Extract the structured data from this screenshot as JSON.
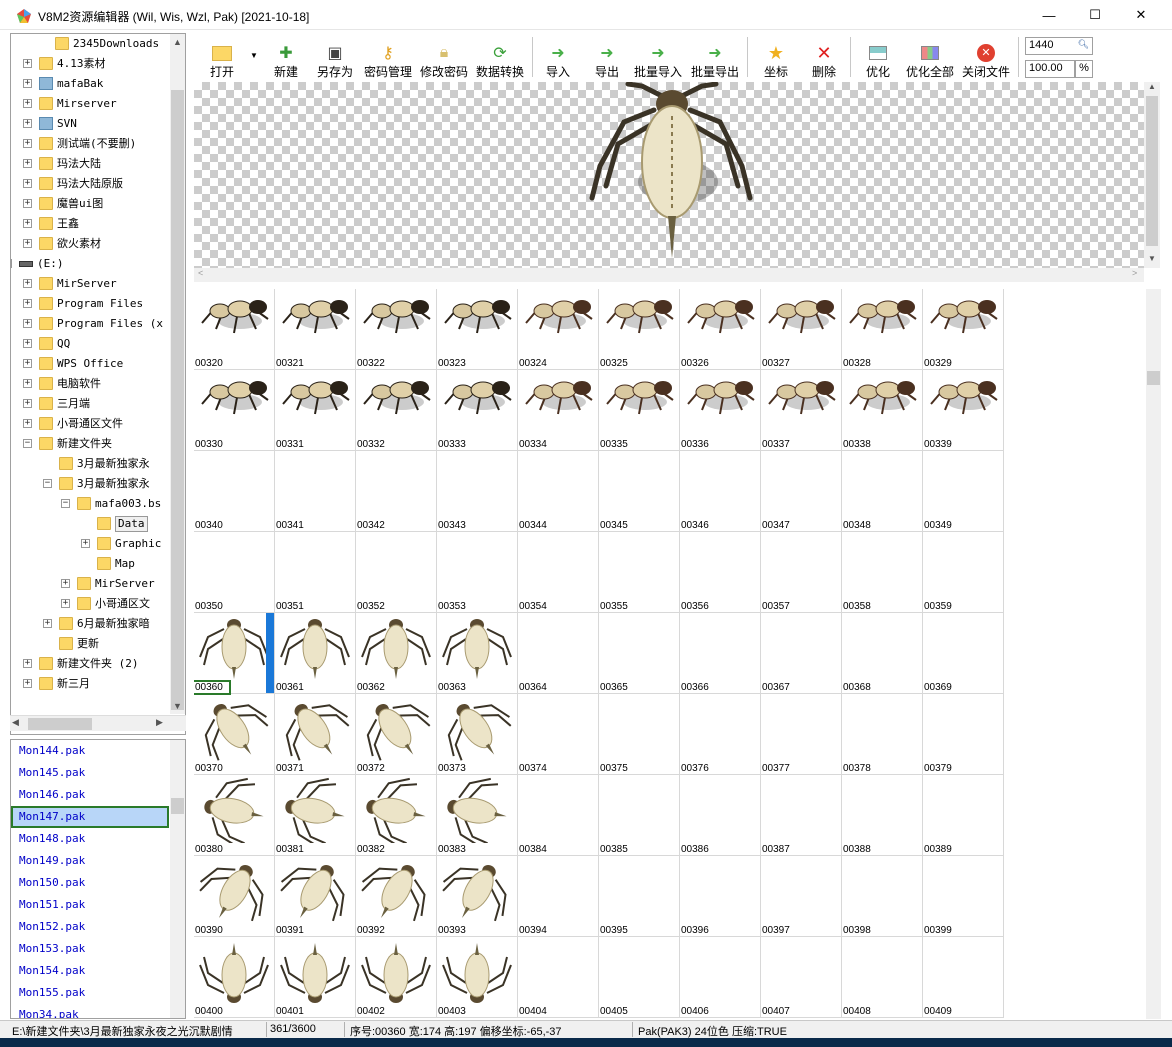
{
  "window": {
    "title": "V8M2资源编辑器 (Wil, Wis, Wzl, Pak) [2021-10-18]",
    "minimize": "—",
    "maximize": "☐",
    "close": "✕"
  },
  "tree": {
    "rows": [
      {
        "label": "2345Downloads",
        "icon": "folder-icon"
      },
      {
        "label": "4.13素材",
        "icon": "folder-icon"
      },
      {
        "label": "mafaBak",
        "icon": "network-folder-icon"
      },
      {
        "label": "Mirserver",
        "icon": "folder-icon"
      },
      {
        "label": "SVN",
        "icon": "network-folder-icon"
      },
      {
        "label": "测试端(不要删)",
        "icon": "folder-icon"
      },
      {
        "label": "玛法大陆",
        "icon": "folder-icon"
      },
      {
        "label": "玛法大陆原版",
        "icon": "folder-icon"
      },
      {
        "label": "魔兽ui图",
        "icon": "folder-icon"
      },
      {
        "label": "王鑫",
        "icon": "folder-icon"
      },
      {
        "label": "欲火素材",
        "icon": "folder-icon"
      },
      {
        "label": "(E:)",
        "icon": "drive-icon"
      },
      {
        "label": "MirServer",
        "icon": "folder-icon"
      },
      {
        "label": "Program Files",
        "icon": "folder-icon"
      },
      {
        "label": "Program Files (x",
        "icon": "folder-icon"
      },
      {
        "label": "QQ",
        "icon": "folder-icon"
      },
      {
        "label": "WPS Office",
        "icon": "folder-icon"
      },
      {
        "label": "电脑软件",
        "icon": "folder-icon"
      },
      {
        "label": "三月端",
        "icon": "folder-icon"
      },
      {
        "label": "小哥通区文件",
        "icon": "folder-icon"
      },
      {
        "label": "新建文件夹",
        "icon": "folder-icon"
      },
      {
        "label": "3月最新独家永",
        "icon": "folder-icon"
      },
      {
        "label": "3月最新独家永",
        "icon": "folder-icon"
      },
      {
        "label": "mafa003.bs",
        "icon": "folder-icon"
      },
      {
        "label": "Data",
        "icon": "folder-icon"
      },
      {
        "label": "Graphic",
        "icon": "folder-icon"
      },
      {
        "label": "Map",
        "icon": "folder-icon"
      },
      {
        "label": "MirServer",
        "icon": "folder-icon"
      },
      {
        "label": "小哥通区文",
        "icon": "folder-icon"
      },
      {
        "label": "6月最新独家暗",
        "icon": "folder-icon"
      },
      {
        "label": "更新",
        "icon": "folder-icon"
      },
      {
        "label": "新建文件夹 (2)",
        "icon": "folder-icon"
      },
      {
        "label": "新三月",
        "icon": "folder-icon"
      }
    ]
  },
  "files": [
    "Mon144.pak",
    "Mon145.pak",
    "Mon146.pak",
    "Mon147.pak",
    "Mon148.pak",
    "Mon149.pak",
    "Mon150.pak",
    "Mon151.pak",
    "Mon152.pak",
    "Mon153.pak",
    "Mon154.pak",
    "Mon155.pak",
    "Mon34.pak"
  ],
  "selected_file": "Mon147.pak",
  "toolbar": {
    "open": "打开",
    "new": "新建",
    "save_as": "另存为",
    "password": "密码管理",
    "change_password": "修改密码",
    "convert": "数据转换",
    "import": "导入",
    "export": "导出",
    "batch_import": "批量导入",
    "batch_export": "批量导出",
    "coords": "坐标",
    "delete": "删除",
    "optimize": "优化",
    "optimize_all": "优化全部",
    "close_file": "关闭文件",
    "index_value": "1440",
    "zoom_value": "100.00",
    "zoom_unit": "%"
  },
  "grid": {
    "labels": [
      "00320",
      "00321",
      "00322",
      "00323",
      "00324",
      "00325",
      "00326",
      "00327",
      "00328",
      "00329",
      "00330",
      "00331",
      "00332",
      "00333",
      "00334",
      "00335",
      "00336",
      "00337",
      "00338",
      "00339",
      "00340",
      "00341",
      "00342",
      "00343",
      "00344",
      "00345",
      "00346",
      "00347",
      "00348",
      "00349",
      "00350",
      "00351",
      "00352",
      "00353",
      "00354",
      "00355",
      "00356",
      "00357",
      "00358",
      "00359",
      "00360",
      "00361",
      "00362",
      "00363",
      "00364",
      "00365",
      "00366",
      "00367",
      "00368",
      "00369",
      "00370",
      "00371",
      "00372",
      "00373",
      "00374",
      "00375",
      "00376",
      "00377",
      "00378",
      "00379",
      "00380",
      "00381",
      "00382",
      "00383",
      "00384",
      "00385",
      "00386",
      "00387",
      "00388",
      "00389",
      "00390",
      "00391",
      "00392",
      "00393",
      "00394",
      "00395",
      "00396",
      "00397",
      "00398",
      "00399",
      "00400",
      "00401",
      "00402",
      "00403",
      "00404",
      "00405",
      "00406",
      "00407",
      "00408",
      "00409"
    ],
    "selected": "00360"
  },
  "status": {
    "path": "E:\\新建文件夹\\3月最新独家永夜之光沉默剧情",
    "count": "361/3600",
    "info": "序号:00360 宽:174 高:197 偏移坐标:-65,-37",
    "format": "Pak(PAK3) 24位色 压缩:TRUE"
  }
}
